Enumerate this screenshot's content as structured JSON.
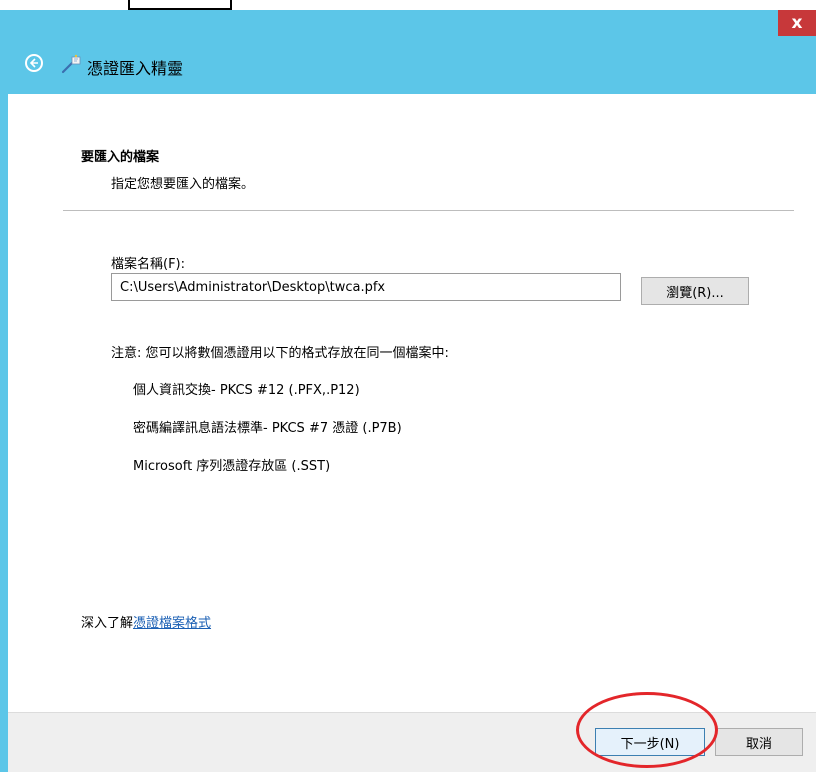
{
  "window": {
    "close_symbol": "x",
    "title": "憑證匯入精靈"
  },
  "section": {
    "title": "要匯入的檔案",
    "subtitle": "指定您想要匯入的檔案。"
  },
  "file": {
    "label": "檔案名稱(F):",
    "value": "C:\\Users\\Administrator\\Desktop\\twca.pfx",
    "browse_label": "瀏覽(R)..."
  },
  "note": {
    "text": "注意: 您可以將數個憑證用以下的格式存放在同一個檔案中:",
    "formats": [
      "個人資訊交換- PKCS #12 (.PFX,.P12)",
      "密碼編譯訊息語法標準- PKCS #7 憑證 (.P7B)",
      "Microsoft 序列憑證存放區 (.SST)"
    ]
  },
  "learn_more": {
    "prefix": "深入了解",
    "link": "憑證檔案格式"
  },
  "footer": {
    "next_label": "下一步(N)",
    "cancel_label": "取消"
  },
  "colors": {
    "header_bg": "#5cc6e8",
    "close_bg": "#c7383a",
    "highlight": "#e3262a",
    "link": "#1a5fb4"
  },
  "icons": {
    "back": "back-arrow-icon",
    "wizard": "certificate-wizard-icon",
    "close": "close-icon"
  }
}
